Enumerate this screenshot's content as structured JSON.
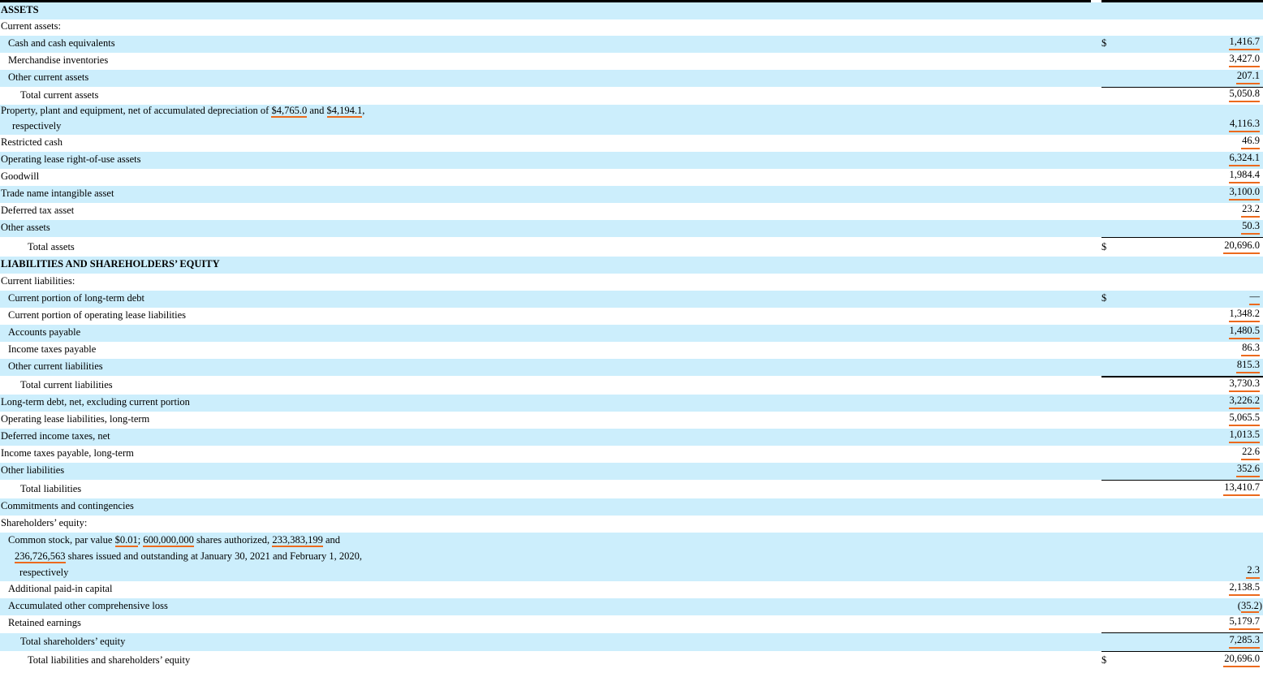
{
  "rows": [
    {
      "label": "ASSETS"
    },
    {
      "label": "Current assets:"
    },
    {
      "label": "Cash and cash equivalents",
      "dollar": "$",
      "amount": "1,416.7"
    },
    {
      "label": "Merchandise inventories",
      "amount": "3,427.0"
    },
    {
      "label": "Other current assets",
      "amount": "207.1"
    },
    {
      "label": "Total current assets",
      "amount": "5,050.8"
    },
    {
      "label_a": "Property, plant and equipment, net of accumulated depreciation of ",
      "val1": "$4,765.0",
      "label_b": " and ",
      "val2": "$4,194.1",
      "label_c": ",",
      "label_d": "respectively",
      "amount": "4,116.3"
    },
    {
      "label": "Restricted cash",
      "amount": "46.9"
    },
    {
      "label": "Operating lease right-of-use assets",
      "amount": "6,324.1"
    },
    {
      "label": "Goodwill",
      "amount": "1,984.4"
    },
    {
      "label": "Trade name intangible asset",
      "amount": "3,100.0"
    },
    {
      "label": "Deferred tax asset",
      "amount": "23.2"
    },
    {
      "label": "Other assets",
      "amount": "50.3"
    },
    {
      "label": "Total assets",
      "dollar": "$",
      "amount": "20,696.0"
    },
    {
      "label": "LIABILITIES AND SHAREHOLDERS’ EQUITY"
    },
    {
      "label": "Current liabilities:"
    },
    {
      "label": "Current portion of long-term debt",
      "dollar": "$",
      "amount": "—"
    },
    {
      "label": "Current portion of operating lease liabilities",
      "amount": "1,348.2"
    },
    {
      "label": "Accounts payable",
      "amount": "1,480.5"
    },
    {
      "label": "Income taxes payable",
      "amount": "86.3"
    },
    {
      "label": "Other current liabilities",
      "amount": "815.3"
    },
    {
      "label": "Total current liabilities",
      "amount": "3,730.3"
    },
    {
      "label": "Long-term debt, net, excluding current portion",
      "amount": "3,226.2"
    },
    {
      "label": "Operating lease liabilities, long-term",
      "amount": "5,065.5"
    },
    {
      "label": "Deferred income taxes, net",
      "amount": "1,013.5"
    },
    {
      "label": "Income taxes payable, long-term",
      "amount": "22.6"
    },
    {
      "label": "Other liabilities",
      "amount": "352.6"
    },
    {
      "label": "Total liabilities",
      "amount": "13,410.7"
    },
    {
      "label": "Commitments and contingencies"
    },
    {
      "label": "Shareholders’ equity:"
    },
    {
      "l1a": "Common stock, par value ",
      "v1": "$0.01",
      "l1b": "; ",
      "v2": "600,000,000",
      "l1c": " shares authorized, ",
      "v3": "233,383,199",
      "l1d": " and",
      "v4": "236,726,563",
      "l2": " shares issued and outstanding at January 30, 2021 and February 1, 2020,",
      "l3": "respectively",
      "amount": "2.3"
    },
    {
      "label": "Additional paid-in capital",
      "amount": "2,138.5"
    },
    {
      "label": "Accumulated other comprehensive loss",
      "amount": "35.2",
      "open": "(",
      "close": ")"
    },
    {
      "label": "Retained earnings",
      "amount": "5,179.7"
    },
    {
      "label": "Total shareholders’ equity",
      "amount": "7,285.3"
    },
    {
      "label": "Total liabilities and shareholders’ equity",
      "dollar": "$",
      "amount": "20,696.0"
    }
  ]
}
